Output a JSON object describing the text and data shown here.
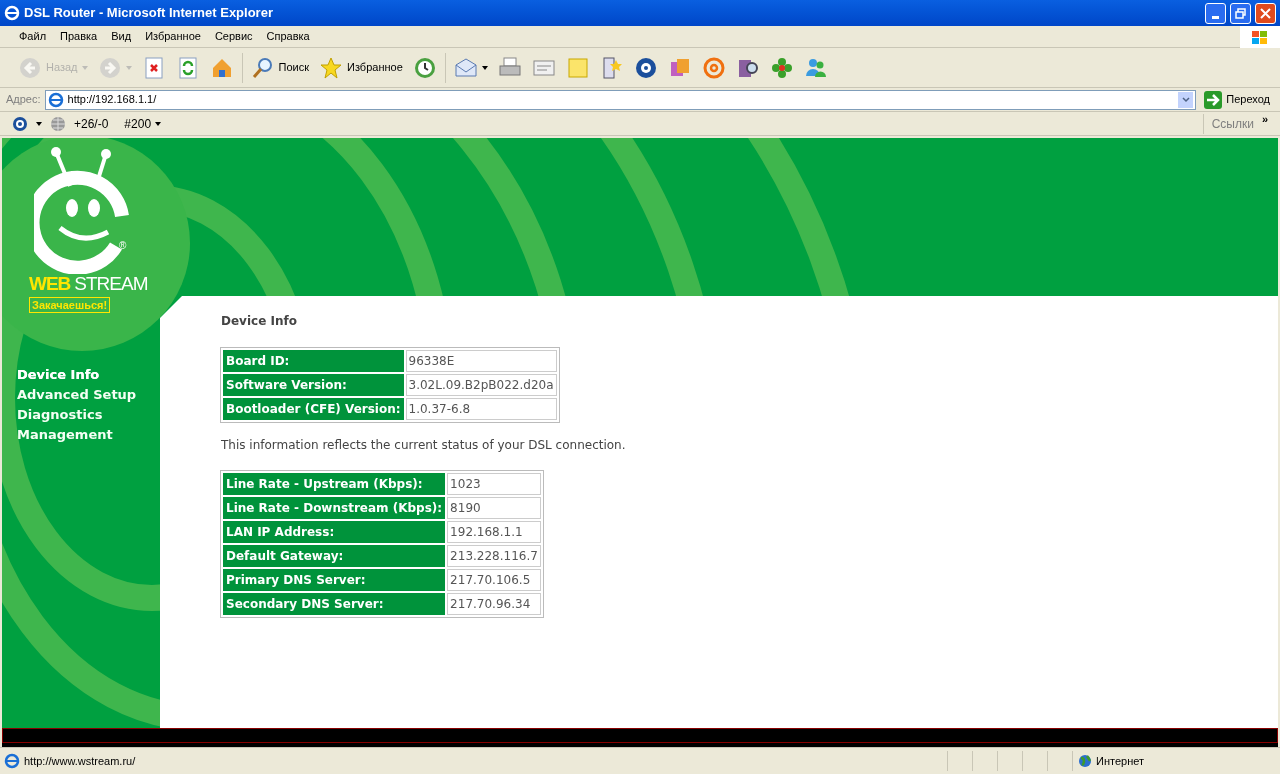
{
  "window": {
    "title": "DSL Router - Microsoft Internet Explorer"
  },
  "menu": [
    "Файл",
    "Правка",
    "Вид",
    "Избранное",
    "Сервис",
    "Справка"
  ],
  "toolbar": [
    {
      "kind": "back",
      "label": "Назад",
      "disabled": true
    },
    {
      "kind": "forward",
      "disabled": true
    },
    {
      "kind": "stop",
      "disabled": false
    },
    {
      "kind": "refresh",
      "disabled": false
    },
    {
      "kind": "home",
      "disabled": false
    },
    {
      "kind": "search",
      "label": "Поиск",
      "disabled": false
    },
    {
      "kind": "favorites",
      "label": "Избранное",
      "disabled": false
    },
    {
      "kind": "history",
      "disabled": false
    },
    {
      "kind": "mail",
      "disabled": false
    },
    {
      "kind": "print",
      "disabled": false
    },
    {
      "kind": "edit",
      "disabled": false
    },
    {
      "kind": "note",
      "disabled": false
    },
    {
      "kind": "star",
      "disabled": false
    },
    {
      "kind": "disc",
      "disabled": false
    },
    {
      "kind": "people",
      "disabled": false
    },
    {
      "kind": "at",
      "disabled": false
    },
    {
      "kind": "book",
      "disabled": false
    },
    {
      "kind": "flower",
      "disabled": false
    },
    {
      "kind": "messenger",
      "disabled": false
    }
  ],
  "address_bar": {
    "label": "Адрес:",
    "url": "http://192.168.1.1/",
    "go": "Переход"
  },
  "links_bar": {
    "counter": "+26/-0",
    "rank": "#200",
    "links": "Ссылки",
    "more": "»"
  },
  "logo": {
    "brand_first": "WEB",
    "brand_second": "STREAM",
    "registered": "®",
    "slogan": "Закачаешься!"
  },
  "sidebar": {
    "items": [
      {
        "label": "Device Info",
        "selected": true
      },
      {
        "label": "Advanced Setup",
        "selected": false
      },
      {
        "label": "Diagnostics",
        "selected": false
      },
      {
        "label": "Management",
        "selected": false
      }
    ]
  },
  "page": {
    "title": "Device Info",
    "device_table": [
      [
        "Board ID:",
        "96338E"
      ],
      [
        "Software Version:",
        "3.02L.09.B2pB022.d20a"
      ],
      [
        "Bootloader (CFE) Version:",
        "1.0.37-6.8"
      ]
    ],
    "note": "This information reflects the current status of your DSL connection.",
    "connection_table": [
      [
        "Line Rate - Upstream (Kbps):",
        "1023"
      ],
      [
        "Line Rate - Downstream (Kbps):",
        "8190"
      ],
      [
        "LAN IP Address:",
        "192.168.1.1"
      ],
      [
        "Default Gateway:",
        "213.228.116.7"
      ],
      [
        "Primary DNS Server:",
        "217.70.106.5"
      ],
      [
        "Secondary DNS Server:",
        "217.70.96.34"
      ]
    ]
  },
  "status_bar": {
    "url": "http://www.wstream.ru/",
    "zone": "Интернет"
  }
}
